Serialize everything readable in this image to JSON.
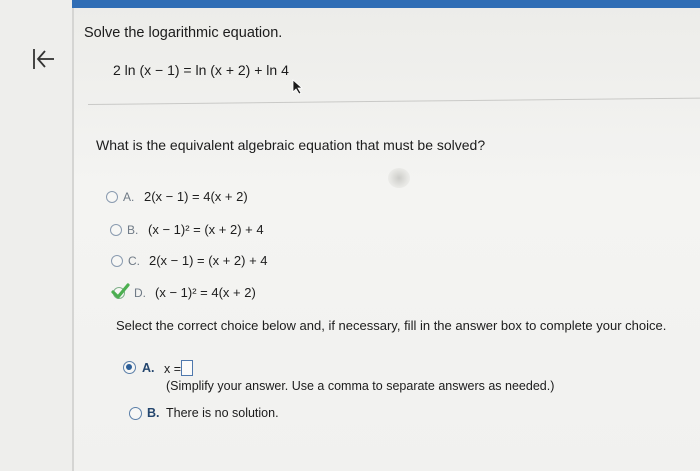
{
  "header": {
    "back_icon": "back-arrow-icon",
    "bar_color": "#2f6db5"
  },
  "problem": {
    "title": "Solve the logarithmic equation.",
    "equation": "2 ln (x − 1) = ln (x + 2) + ln 4"
  },
  "question": {
    "prompt": "What is the equivalent algebraic equation that must be solved?",
    "choices": [
      {
        "letter": "A.",
        "expression": "2(x − 1) = 4(x + 2)",
        "selected": false
      },
      {
        "letter": "B.",
        "expression": "(x − 1)² = (x + 2) + 4",
        "selected": false
      },
      {
        "letter": "C.",
        "expression": "2(x − 1) = (x + 2) + 4",
        "selected": false
      },
      {
        "letter": "D.",
        "expression": "(x − 1)² = 4(x + 2)",
        "selected": true
      }
    ]
  },
  "answer": {
    "instruction": "Select the correct choice below and, if necessary, fill in the answer box to complete your choice.",
    "option_a_letter": "A.",
    "option_a_prefix": "x =",
    "answer_value": "",
    "option_a_hint": "(Simplify your answer. Use a comma to separate answers as needed.)",
    "option_b_letter": "B.",
    "option_b_text": "There is no solution.",
    "selected": "A"
  },
  "colors": {
    "accent": "#2d5f98",
    "correct_check": "#4caf50"
  }
}
